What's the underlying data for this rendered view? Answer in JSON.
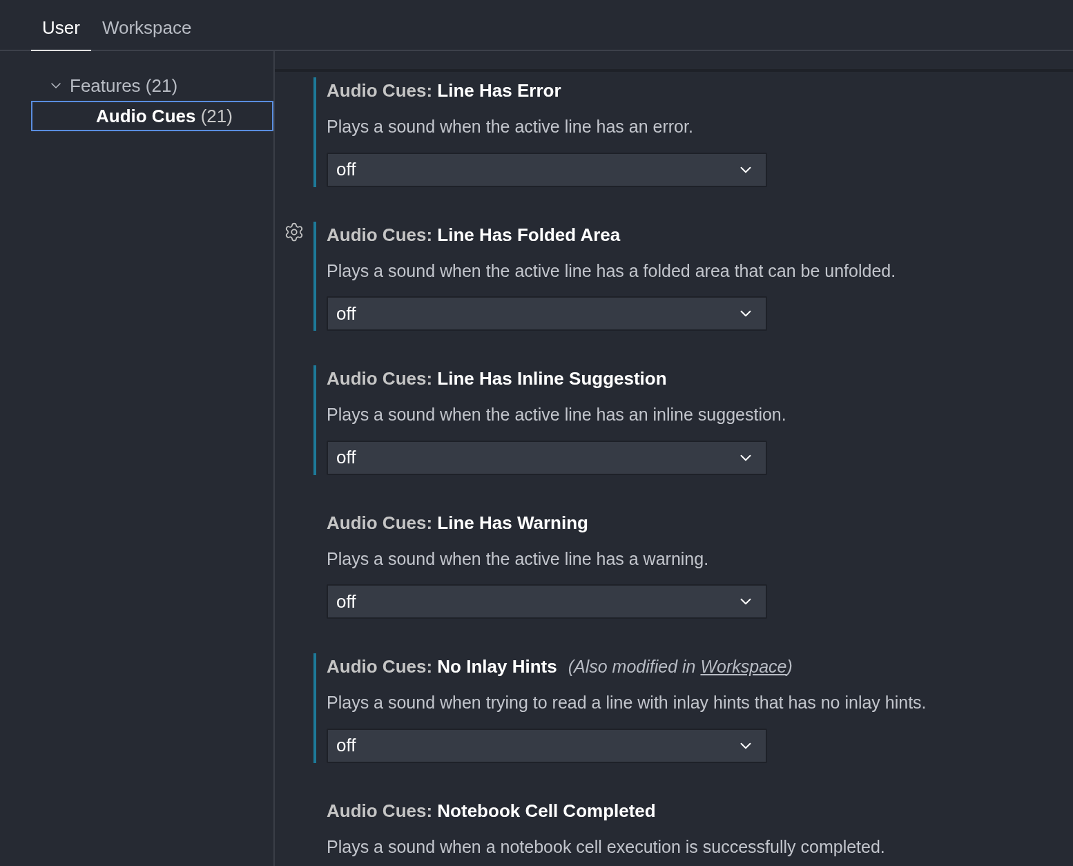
{
  "tabs": [
    {
      "label": "User",
      "selected": true
    },
    {
      "label": "Workspace",
      "selected": false
    }
  ],
  "tree": [
    {
      "label": "Features",
      "count": "(21)",
      "expanded": true,
      "selected": false,
      "children": [
        {
          "label": "Audio Cues",
          "count": "(21)",
          "selected": true
        }
      ]
    }
  ],
  "settings": [
    {
      "category": "Audio Cues:",
      "title": "Line Has Error",
      "description": "Plays a sound when the active line has an error.",
      "value": "off",
      "modified": true,
      "hovered": false
    },
    {
      "category": "Audio Cues:",
      "title": "Line Has Folded Area",
      "description": "Plays a sound when the active line has a folded area that can be unfolded.",
      "value": "off",
      "modified": true,
      "hovered": true
    },
    {
      "category": "Audio Cues:",
      "title": "Line Has Inline Suggestion",
      "description": "Plays a sound when the active line has an inline suggestion.",
      "value": "off",
      "modified": true,
      "hovered": false
    },
    {
      "category": "Audio Cues:",
      "title": "Line Has Warning",
      "description": "Plays a sound when the active line has a warning.",
      "value": "off",
      "modified": false,
      "hovered": false
    },
    {
      "category": "Audio Cues:",
      "title": "No Inlay Hints",
      "note": {
        "prefix": "(Also modified in",
        "link": "Workspace",
        "suffix": ")"
      },
      "description": "Plays a sound when trying to read a line with inlay hints that has no inlay hints.",
      "value": "off",
      "modified": true,
      "hovered": false
    },
    {
      "category": "Audio Cues:",
      "title": "Notebook Cell Completed",
      "description": "Plays a sound when a notebook cell execution is successfully completed.",
      "modified": false,
      "hovered": false
    }
  ]
}
